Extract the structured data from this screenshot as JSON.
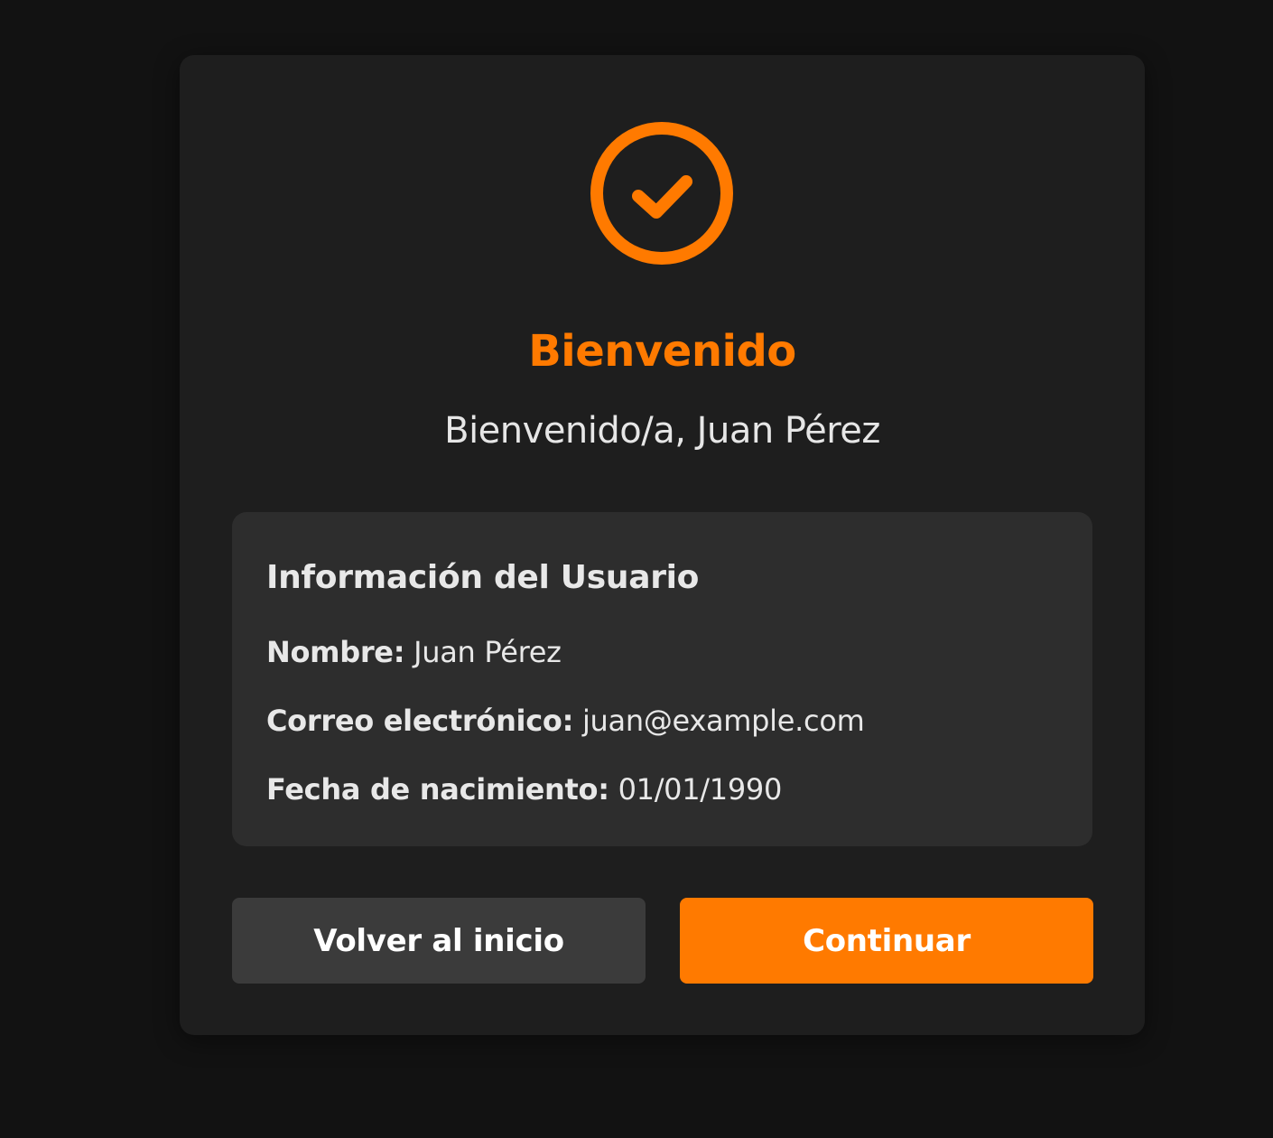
{
  "colors": {
    "background": "#121212",
    "card": "#1e1e1e",
    "info_box": "#2d2d2d",
    "accent": "#ff7a00",
    "text": "#e8e8e8",
    "secondary_button": "#3b3b3b"
  },
  "header": {
    "icon": "check-circle-icon",
    "title": "Bienvenido",
    "subtitle": "Bienvenido/a, Juan Pérez"
  },
  "user_info": {
    "heading": "Información del Usuario",
    "name_label": "Nombre:",
    "name_value": "Juan Pérez",
    "email_label": "Correo electrónico:",
    "email_value": "juan@example.com",
    "birthdate_label": "Fecha de nacimiento:",
    "birthdate_value": "01/01/1990"
  },
  "actions": {
    "back_label": "Volver al inicio",
    "continue_label": "Continuar"
  }
}
